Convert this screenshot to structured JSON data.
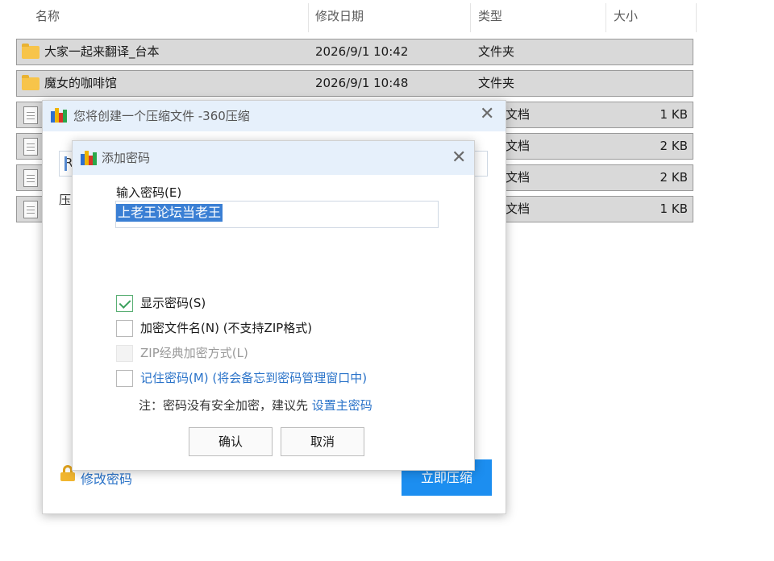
{
  "explorer": {
    "columns": {
      "name": "名称",
      "modified": "修改日期",
      "type": "类型",
      "size": "大小"
    },
    "sort_indicator": "^",
    "rows": [
      {
        "name": "大家一起来翻译_台本",
        "modified": "2026/9/1 10:42",
        "type": "文件夹",
        "size": "",
        "icon": "folder-icon"
      },
      {
        "name": "魔女的咖啡馆",
        "modified": "2026/9/1 10:48",
        "type": "文件夹",
        "size": "",
        "icon": "folder-icon"
      },
      {
        "name": "",
        "modified": "",
        "type": "文档",
        "size": "1 KB",
        "icon": "file-icon"
      },
      {
        "name": "",
        "modified": "",
        "type": "文档",
        "size": "2 KB",
        "icon": "file-icon"
      },
      {
        "name": "",
        "modified": "",
        "type": "文档",
        "size": "2 KB",
        "icon": "file-icon"
      },
      {
        "name": "",
        "modified": "",
        "type": "文档",
        "size": "1 KB",
        "icon": "file-icon"
      }
    ]
  },
  "compress_window": {
    "title": "您将创建一个压缩文件 -360压缩",
    "path_value_visible": "R",
    "partial_label": "压",
    "modify_password_link": "修改密码",
    "compress_now_button": "立即压缩",
    "close_glyph": "✕"
  },
  "password_dialog": {
    "title": "添加密码",
    "close_glyph": "✕",
    "input_label": "输入密码(E)",
    "password_value": "上老王论坛当老王",
    "options": [
      {
        "label": "显示密码(S)",
        "checked": true,
        "disabled": false,
        "style": "normal"
      },
      {
        "label": "加密文件名(N) (不支持ZIP格式)",
        "checked": false,
        "disabled": false,
        "style": "normal"
      },
      {
        "label": "ZIP经典加密方式(L)",
        "checked": false,
        "disabled": true,
        "style": "disabled"
      },
      {
        "label": "记住密码(M) (将会备忘到密码管理窗口中)",
        "checked": false,
        "disabled": false,
        "style": "blue"
      }
    ],
    "note_text": "注：密码没有安全加密，建议先 ",
    "note_link": "设置主密码",
    "ok_button": "确认",
    "cancel_button": "取消"
  },
  "colors": {
    "accent_blue": "#1c8ef0",
    "link_blue": "#2a73c9",
    "titlebar_bg": "#e6f0fb",
    "selected_row_bg": "#d9d9d9",
    "selection_highlight": "#3a7fd4"
  }
}
